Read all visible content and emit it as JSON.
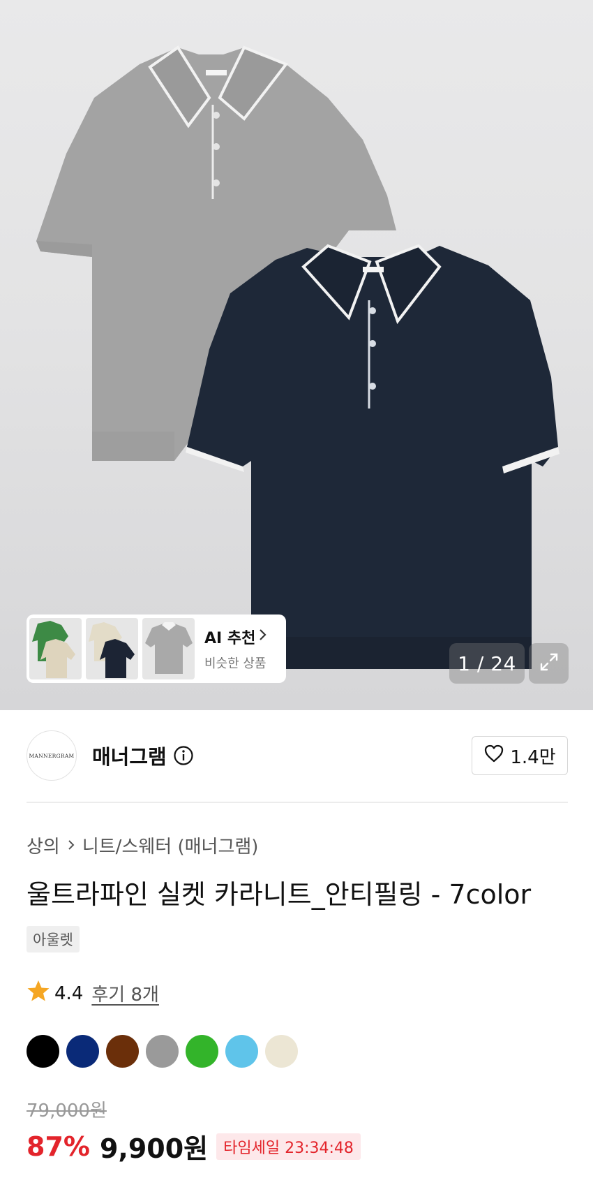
{
  "gallery": {
    "counter": "1 / 24",
    "ai_card": {
      "title": "AI 추천",
      "subtitle": "비슷한 상품"
    }
  },
  "brand": {
    "logo_text": "MANNERGRAM",
    "name": "매너그램",
    "likes": "1.4만"
  },
  "breadcrumb": {
    "category": "상의",
    "subcategory": "니트/스웨터 (매너그램)"
  },
  "product": {
    "title": "울트라파인 실켓 카라니트_안티필링 - 7color",
    "tag": "아울렛",
    "rating": "4.4",
    "reviews": "후기 8개",
    "color_swatches": [
      "#000000",
      "#0a2a78",
      "#6b2f0a",
      "#9a9a9a",
      "#33b42a",
      "#5fc4ea",
      "#ece6d4"
    ],
    "original_price": "79,000원",
    "discount": "87%",
    "price": "9,900원",
    "timesale": "타임세일 23:34:48"
  },
  "colors": {
    "accent_red": "#e3242b",
    "star": "#f5a623"
  }
}
